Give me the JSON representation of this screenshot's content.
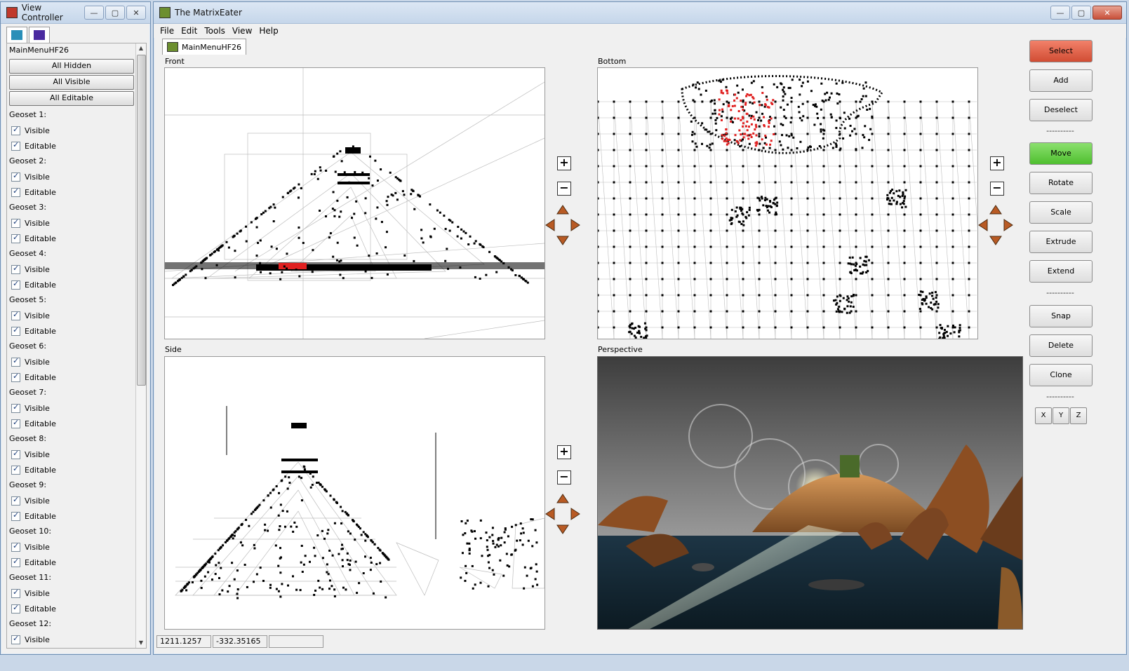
{
  "view_controller": {
    "title": "View Controller",
    "model_name": "MainMenuHF26",
    "buttons": [
      "All Hidden",
      "All Visible",
      "All Editable"
    ],
    "geosets": [
      {
        "name": "Geoset 1:",
        "visible": "Visible",
        "editable": "Editable"
      },
      {
        "name": "Geoset 2:",
        "visible": "Visible",
        "editable": "Editable"
      },
      {
        "name": "Geoset 3:",
        "visible": "Visible",
        "editable": "Editable"
      },
      {
        "name": "Geoset 4:",
        "visible": "Visible",
        "editable": "Editable"
      },
      {
        "name": "Geoset 5:",
        "visible": "Visible",
        "editable": "Editable"
      },
      {
        "name": "Geoset 6:",
        "visible": "Visible",
        "editable": "Editable"
      },
      {
        "name": "Geoset 7:",
        "visible": "Visible",
        "editable": "Editable"
      },
      {
        "name": "Geoset 8:",
        "visible": "Visible",
        "editable": "Editable"
      },
      {
        "name": "Geoset 9:",
        "visible": "Visible",
        "editable": "Editable"
      },
      {
        "name": "Geoset 10:",
        "visible": "Visible",
        "editable": "Editable"
      },
      {
        "name": "Geoset 11:",
        "visible": "Visible",
        "editable": "Editable"
      },
      {
        "name": "Geoset 12:",
        "visible": "Visible",
        "editable": ""
      }
    ]
  },
  "main": {
    "title": "The MatrixEater",
    "menu": [
      "File",
      "Edit",
      "Tools",
      "View",
      "Help"
    ],
    "doc_tab": "MainMenuHF26",
    "views": {
      "front": "Front",
      "bottom": "Bottom",
      "side": "Side",
      "perspective": "Perspective"
    },
    "zoom_in": "+",
    "zoom_out": "−",
    "tools": {
      "select": "Select",
      "add": "Add",
      "deselect": "Deselect",
      "sep1": "----------",
      "move": "Move",
      "rotate": "Rotate",
      "scale": "Scale",
      "extrude": "Extrude",
      "extend": "Extend",
      "sep2": "----------",
      "snap": "Snap",
      "delete": "Delete",
      "clone": "Clone",
      "sep3": "----------"
    },
    "axes": [
      "X",
      "Y",
      "Z"
    ],
    "status": {
      "x": "1211.1257",
      "y": "-332.35165",
      "z": ""
    },
    "colors": {
      "select": "#e0644a",
      "move": "#6fd24e",
      "selected_vertex": "#e02020"
    }
  }
}
